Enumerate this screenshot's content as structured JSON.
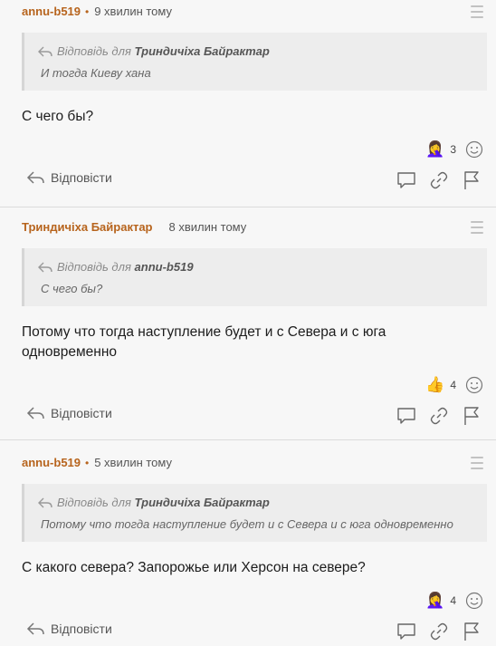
{
  "reply_label": "Відповісти",
  "reply_prefix": "Відповідь для",
  "comments": [
    {
      "author": "annu-b519",
      "time": "9 хвилин тому",
      "quote_author": "Триндичіха Байрактар",
      "quote_text": "И тогда Киеву хана",
      "text": "С чего бы?",
      "reaction_icon": "person-facepalm-icon",
      "reaction_emoji": "🤦‍♀️",
      "reaction_count": "3"
    },
    {
      "author": "Триндичіха Байрактар",
      "time": "8 хвилин тому",
      "quote_author": "annu-b519",
      "quote_text": "С чего бы?",
      "text": "Потому что тогда наступление будет и с Севера и с юга одновременно",
      "reaction_icon": "thumbs-up-icon",
      "reaction_emoji": "👍",
      "reaction_count": "4"
    },
    {
      "author": "annu-b519",
      "time": "5 хвилин тому",
      "quote_author": "Триндичіха Байрактар",
      "quote_text": "Потому что тогда наступление будет и с Севера и с юга одновременно",
      "text": "С какого севера? Запорожье или Херсон на севере?",
      "reaction_icon": "person-facepalm-icon",
      "reaction_emoji": "🤦‍♀️",
      "reaction_count": "4"
    }
  ],
  "colors": {
    "author": "#b7641d",
    "background": "#f7f7f7",
    "quote_bg": "#ededed"
  }
}
